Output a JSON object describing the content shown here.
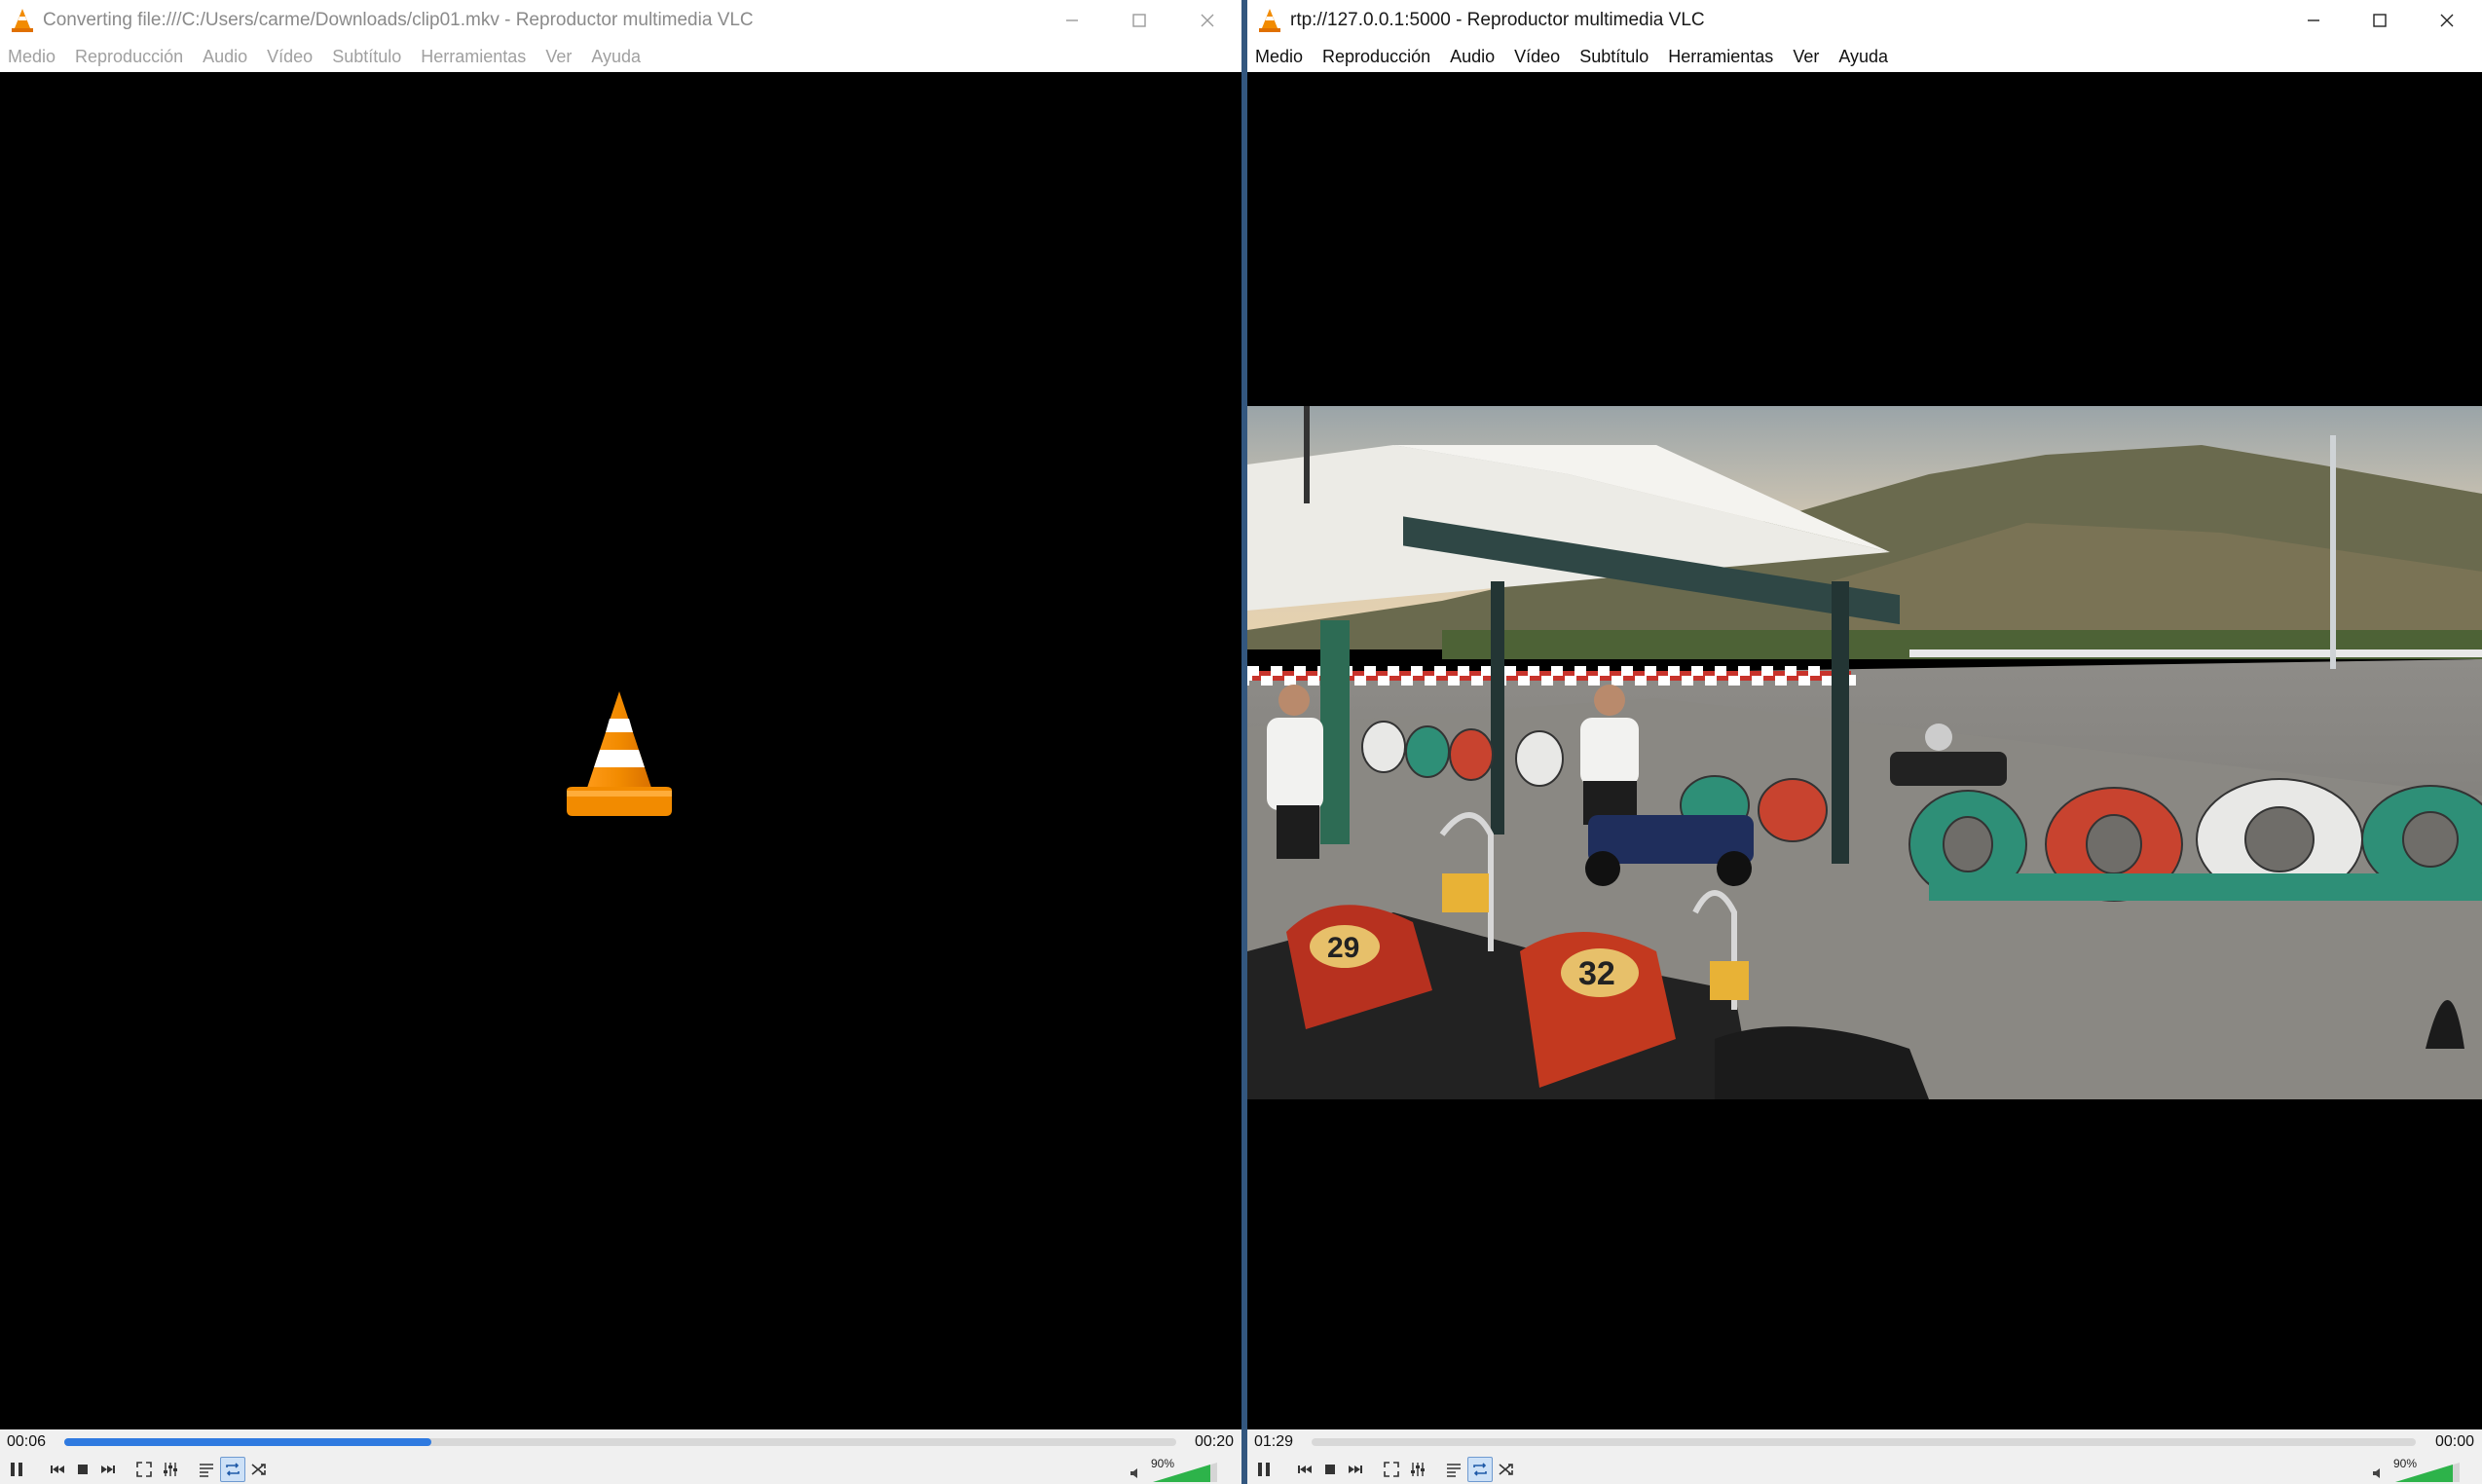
{
  "left_window": {
    "title": "Converting file:///C:/Users/carme/Downloads/clip01.mkv - Reproductor multimedia VLC",
    "menu": [
      "Medio",
      "Reproducción",
      "Audio",
      "Vídeo",
      "Subtítulo",
      "Herramientas",
      "Ver",
      "Ayuda"
    ],
    "time_elapsed": "00:06",
    "time_total": "00:20",
    "progress_fraction": 0.33,
    "volume": "90%",
    "loop_active": true
  },
  "right_window": {
    "title": "rtp://127.0.0.1:5000 - Reproductor multimedia VLC",
    "menu": [
      "Medio",
      "Reproducción",
      "Audio",
      "Vídeo",
      "Subtítulo",
      "Herramientas",
      "Ver",
      "Ayuda"
    ],
    "time_elapsed": "01:29",
    "time_total": "00:00",
    "progress_fraction": 0,
    "volume": "90%",
    "loop_active": true,
    "video_scene": "go-kart track with karts numbered 29 and 32",
    "kart_numbers": [
      "29",
      "32"
    ]
  },
  "colors": {
    "vlc_orange": "#f28b00",
    "seek_fill": "#2f7ae0",
    "volume_green": "#2db34a",
    "desktop_divider": "#33577f"
  },
  "icons": [
    "vlc-cone-icon",
    "minimize-icon",
    "maximize-icon",
    "close-icon",
    "pause-icon",
    "previous-icon",
    "stop-icon",
    "next-icon",
    "fullscreen-icon",
    "extended-settings-icon",
    "playlist-icon",
    "loop-icon",
    "shuffle-icon",
    "speaker-icon"
  ]
}
